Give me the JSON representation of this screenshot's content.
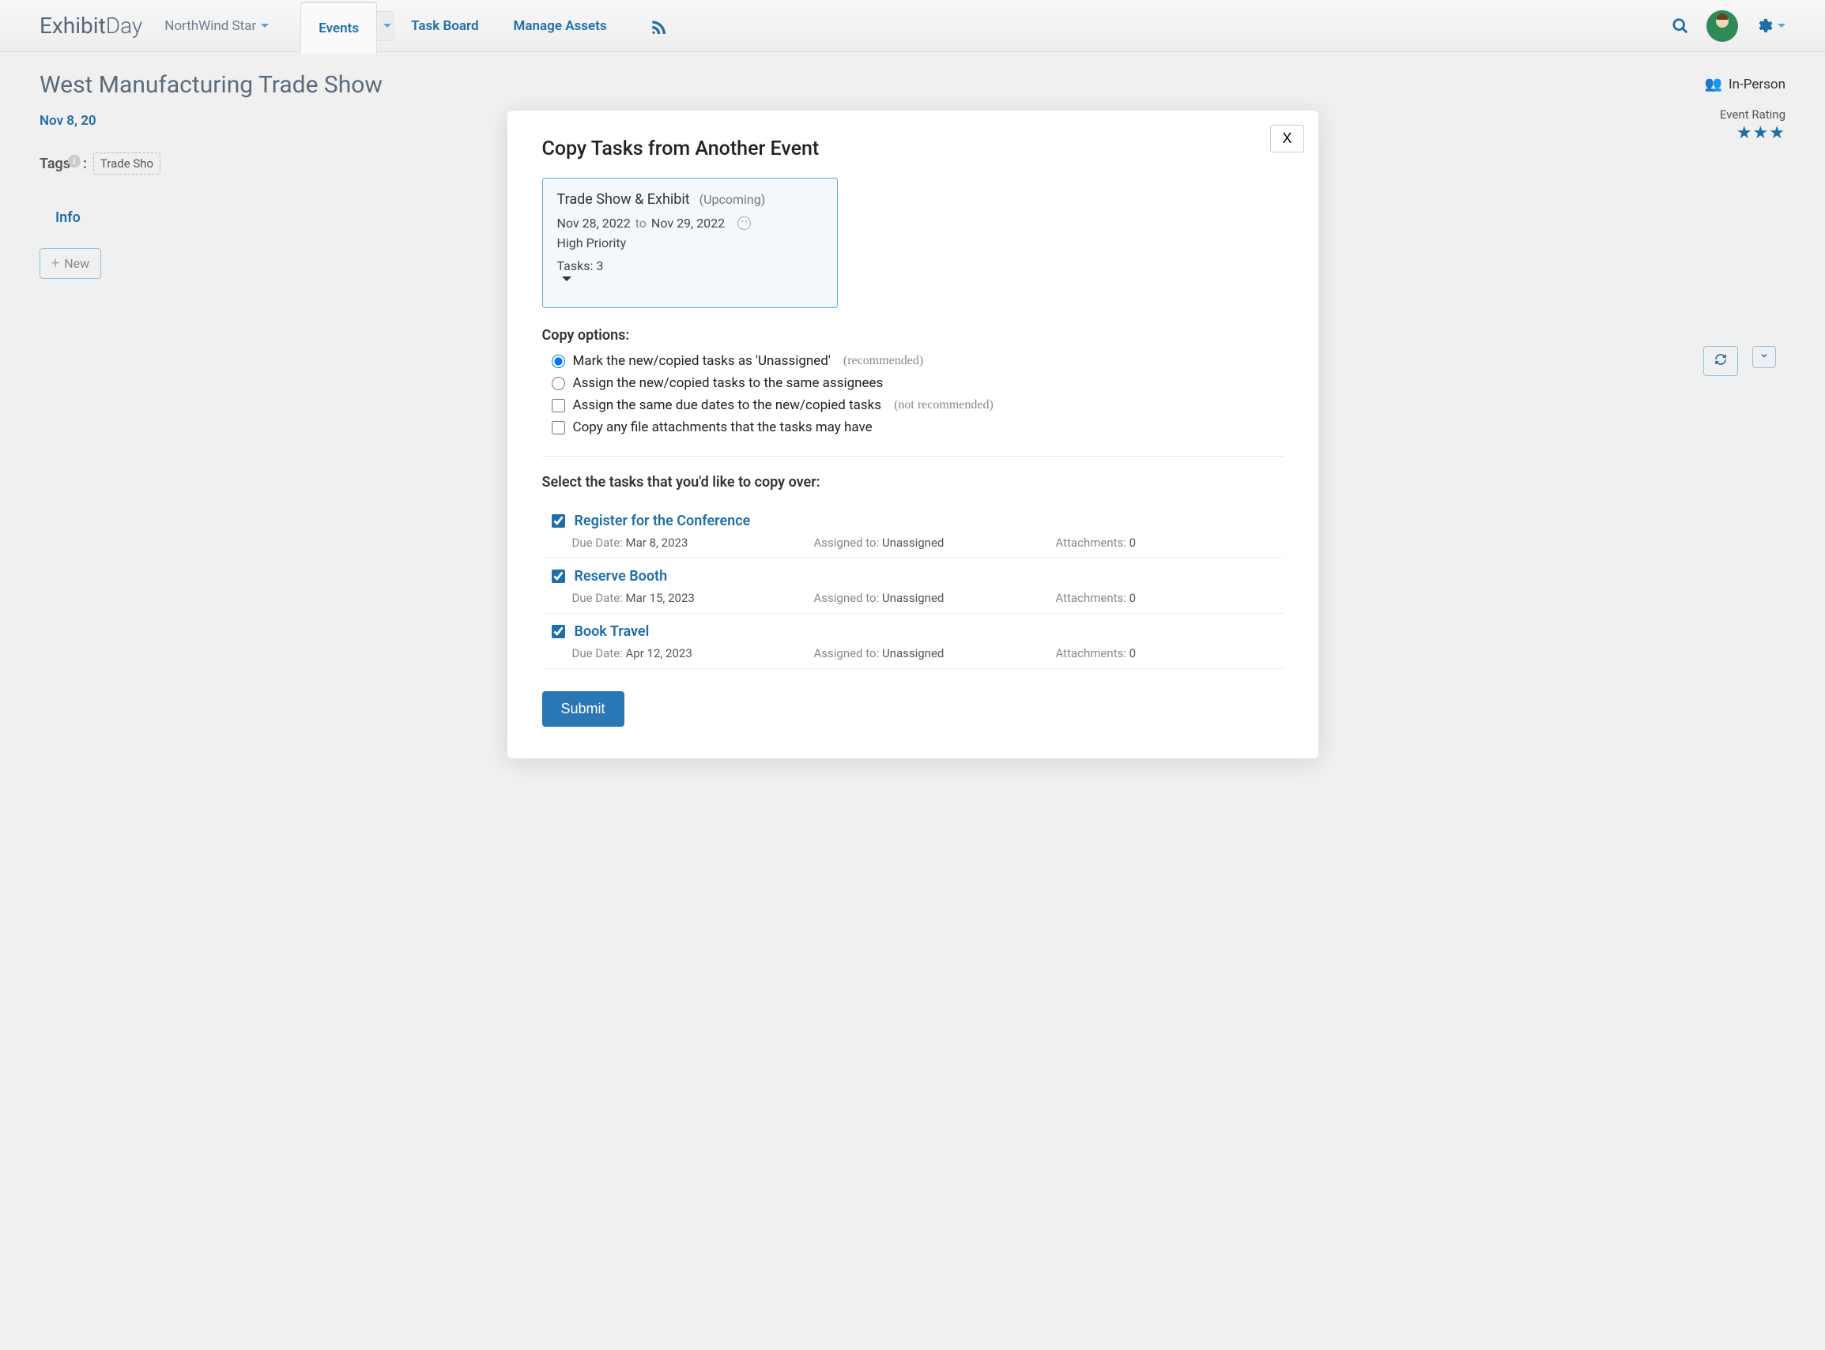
{
  "brand": {
    "part1": "Exhibit",
    "part2": "Day"
  },
  "workspace": "NorthWind Star",
  "nav": {
    "events": "Events",
    "taskboard": "Task Board",
    "manage_assets": "Manage Assets"
  },
  "page": {
    "title": "West Manufacturing Trade Show",
    "date": "Nov 8, 20",
    "tags_label": "Tags",
    "tag_chip": "Trade Sho",
    "info_tab": "Info",
    "new_btn": "New",
    "in_person": "In-Person",
    "event_rating_label": "Event Rating"
  },
  "modal": {
    "title": "Copy Tasks from Another Event",
    "close": "X",
    "source": {
      "name": "Trade Show & Exhibit",
      "status": "(Upcoming)",
      "date_from": "Nov 28, 2022",
      "date_to_word": "to",
      "date_to": "Nov 29, 2022",
      "priority": "High Priority",
      "tasks_label": "Tasks: 3"
    },
    "copy_options_label": "Copy options:",
    "options": {
      "unassigned": "Mark the new/copied tasks as 'Unassigned'",
      "unassigned_note": "(recommended)",
      "same_assignees": "Assign the new/copied tasks to the same assignees",
      "same_dates": "Assign the same due dates to the new/copied tasks",
      "same_dates_note": "(not recommended)",
      "attachments": "Copy any file attachments that the tasks may have"
    },
    "select_tasks_label": "Select the tasks that you'd like to copy over:",
    "tasks": [
      {
        "name": "Register for the Conference",
        "due": "Mar 8, 2023",
        "assigned": "Unassigned",
        "attachments": "0"
      },
      {
        "name": "Reserve Booth",
        "due": "Mar 15, 2023",
        "assigned": "Unassigned",
        "attachments": "0"
      },
      {
        "name": "Book Travel",
        "due": "Apr 12, 2023",
        "assigned": "Unassigned",
        "attachments": "0"
      }
    ],
    "meta_labels": {
      "due": "Due Date: ",
      "assigned": "Assigned to: ",
      "attach": "Attachments: "
    },
    "submit": "Submit"
  }
}
